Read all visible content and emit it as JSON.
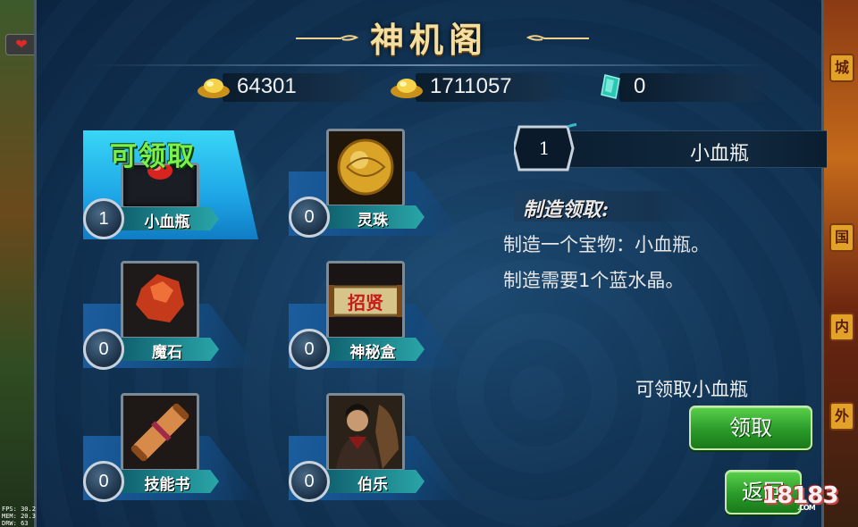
{
  "title": "神机阁",
  "currencies": [
    {
      "icon": "gold-ingot-icon",
      "value": "64301"
    },
    {
      "icon": "gold-ingot-icon",
      "value": "1711057"
    },
    {
      "icon": "crystal-icon",
      "value": "0"
    }
  ],
  "items": [
    {
      "name": "小血瓶",
      "count": "1",
      "selected": true,
      "claim_label": "可领取",
      "icon": "red-potion-icon"
    },
    {
      "name": "灵珠",
      "count": "0",
      "selected": false,
      "icon": "golden-orb-icon"
    },
    {
      "name": "魔石",
      "count": "0",
      "selected": false,
      "icon": "red-stone-icon"
    },
    {
      "name": "神秘盒",
      "count": "0",
      "selected": false,
      "icon": "mystery-box-icon",
      "icon_text": "招贤"
    },
    {
      "name": "技能书",
      "count": "0",
      "selected": false,
      "icon": "scroll-icon"
    },
    {
      "name": "伯乐",
      "count": "0",
      "selected": false,
      "icon": "hero-portrait-icon"
    }
  ],
  "detail": {
    "count": "1",
    "name": "小血瓶",
    "make_heading": "制造领取:",
    "desc_line1": "制造一个宝物：小血瓶。",
    "desc_line2": "制造需要1个蓝水晶。"
  },
  "claimable_text": "可领取小血瓶",
  "claim_button": "领取",
  "back_button": "返回",
  "watermark": "18183",
  "watermark_sub": ".COM",
  "debug": [
    "FPS: 30.2",
    "MEM: 20.3",
    "DRW: 63"
  ],
  "side_tags": [
    "城",
    "国",
    "内",
    "外"
  ],
  "colors": {
    "claim_green": "#7cf04a",
    "panel_blue": "#123556",
    "title_gold": "#f5dfa0"
  }
}
